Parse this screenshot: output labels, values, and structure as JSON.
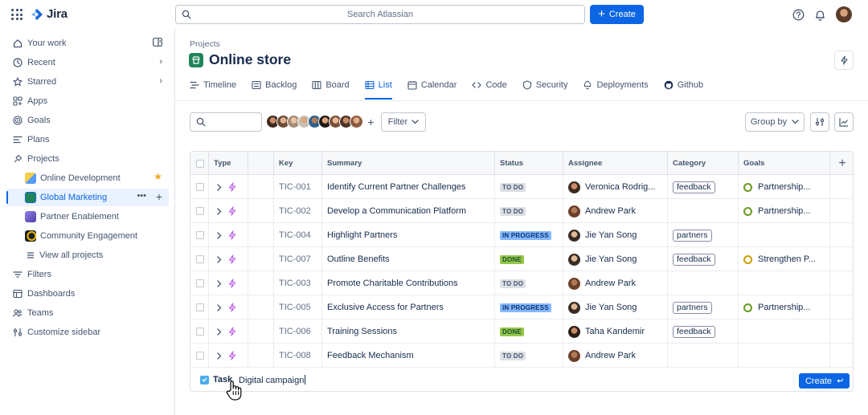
{
  "app": {
    "name": "Jira"
  },
  "top": {
    "search_placeholder": "Search Atlassian",
    "create_label": "Create"
  },
  "sidebar": {
    "items": [
      {
        "label": "Your work",
        "icon": "home-icon"
      },
      {
        "label": "Recent",
        "icon": "clock-icon"
      },
      {
        "label": "Starred",
        "icon": "star-icon"
      },
      {
        "label": "Apps",
        "icon": "apps-icon"
      },
      {
        "label": "Goals",
        "icon": "goal-icon"
      },
      {
        "label": "Plans",
        "icon": "plans-icon"
      },
      {
        "label": "Projects",
        "icon": "projects-icon"
      }
    ],
    "projects": [
      {
        "label": "Online Development",
        "color": "#f5cd47",
        "starred": true
      },
      {
        "label": "Global Marketing",
        "color": "#1f845a",
        "active": true
      },
      {
        "label": "Partner Enablement",
        "color": "#6e5dc6"
      },
      {
        "label": "Community Engagement",
        "color": "#1d2125"
      }
    ],
    "view_all": "View all projects",
    "bottom_items": [
      {
        "label": "Filters",
        "icon": "filter-icon"
      },
      {
        "label": "Dashboards",
        "icon": "dashboard-icon"
      },
      {
        "label": "Teams",
        "icon": "teams-icon"
      },
      {
        "label": "Customize sidebar",
        "icon": "customize-icon"
      }
    ]
  },
  "page": {
    "breadcrumb": "Projects",
    "title": "Online store",
    "tabs": [
      {
        "label": "Timeline",
        "icon": "timeline-icon"
      },
      {
        "label": "Backlog",
        "icon": "backlog-icon"
      },
      {
        "label": "Board",
        "icon": "board-icon"
      },
      {
        "label": "List",
        "icon": "list-icon",
        "active": true
      },
      {
        "label": "Calendar",
        "icon": "calendar-icon"
      },
      {
        "label": "Code",
        "icon": "code-icon"
      },
      {
        "label": "Security",
        "icon": "shield-icon"
      },
      {
        "label": "Deployments",
        "icon": "deployments-icon"
      },
      {
        "label": "Github",
        "icon": "github-icon"
      }
    ]
  },
  "filters": {
    "filter_label": "Filter",
    "group_by_label": "Group by"
  },
  "table": {
    "headers": {
      "type": "Type",
      "key": "Key",
      "summary": "Summary",
      "status": "Status",
      "assignee": "Assignee",
      "category": "Category",
      "goals": "Goals"
    },
    "rows": [
      {
        "key": "TIC-001",
        "summary": "Identify Current Partner Challenges",
        "status": "TO DO",
        "status_kind": "todo",
        "assignee": "Veronica Rodrig...",
        "category": "feedback",
        "goal": "Partnership...",
        "goal_kind": "green"
      },
      {
        "key": "TIC-002",
        "summary": "Develop a Communication Platform",
        "status": "TO DO",
        "status_kind": "todo",
        "assignee": "Andrew Park",
        "category": "",
        "goal": "Partnership...",
        "goal_kind": "green"
      },
      {
        "key": "TIC-004",
        "summary": "Highlight Partners",
        "status": "IN PROGRESS",
        "status_kind": "progress",
        "assignee": "Jie Yan Song",
        "category": "partners",
        "goal": "",
        "goal_kind": ""
      },
      {
        "key": "TIC-007",
        "summary": "Outline Benefits",
        "status": "DONE",
        "status_kind": "done",
        "assignee": "Jie Yan Song",
        "category": "feedback",
        "goal": "Strengthen P...",
        "goal_kind": "amber"
      },
      {
        "key": "TIC-003",
        "summary": "Promote Charitable Contributions",
        "status": "TO DO",
        "status_kind": "todo",
        "assignee": "Andrew Park",
        "category": "",
        "goal": "",
        "goal_kind": ""
      },
      {
        "key": "TIC-005",
        "summary": "Exclusive Access for Partners",
        "status": "IN PROGRESS",
        "status_kind": "progress",
        "assignee": "Jie Yan Song",
        "category": "partners",
        "goal": "Partnership...",
        "goal_kind": "green"
      },
      {
        "key": "TIC-006",
        "summary": "Training Sessions",
        "status": "DONE",
        "status_kind": "done",
        "assignee": "Taha Kandemir",
        "category": "feedback",
        "goal": "",
        "goal_kind": ""
      },
      {
        "key": "TIC-008",
        "summary": "Feedback Mechanism",
        "status": "TO DO",
        "status_kind": "todo",
        "assignee": "Andrew Park",
        "category": "",
        "goal": "",
        "goal_kind": ""
      }
    ],
    "create_row": {
      "type_label": "Task",
      "input_value": "Digital campaign",
      "create_label": "Create"
    }
  },
  "colors": {
    "accent": "#0c66e4",
    "todo": "#dcdfe4",
    "in_progress": "#85b8ff",
    "done": "#94c748"
  }
}
